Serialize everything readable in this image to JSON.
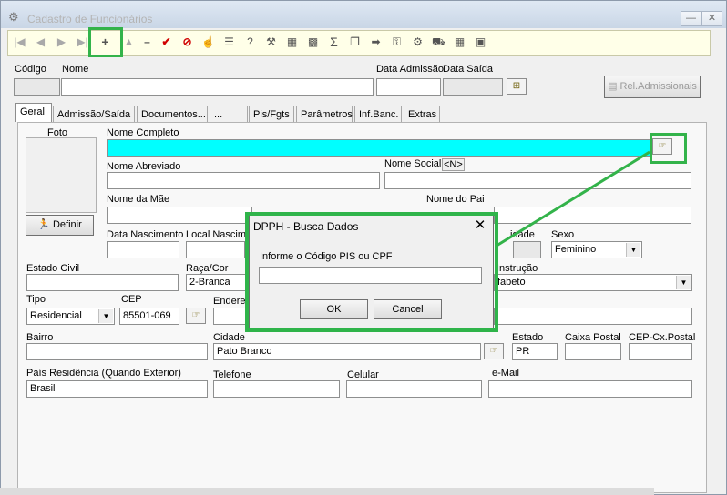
{
  "window": {
    "title": "Cadastro de Funcionários"
  },
  "header": {
    "codigo_label": "Código",
    "nome_label": "Nome",
    "data_admissao_label": "Data Admissão",
    "data_saida_label": "Data Saída",
    "rel_button": "Rel.Admissionais"
  },
  "tabs": [
    "Geral",
    "Admissão/Saída",
    "Documentos...",
    "...",
    "Pis/Fgts",
    "Parâmetros",
    "Inf.Banc.",
    "Extras"
  ],
  "form": {
    "foto_label": "Foto",
    "definir_button": "Definir",
    "nome_completo_label": "Nome Completo",
    "nome_abreviado_label": "Nome Abreviado",
    "nome_social_label": "Nome Social",
    "nome_social_button": "<N>",
    "nome_mae_label": "Nome da Mãe",
    "nome_pai_label": "Nome do Pai",
    "data_nascimento_label": "Data Nascimento",
    "local_nascimento_label": "Local Nascim",
    "idade_label": "idade",
    "sexo_label": "Sexo",
    "sexo_value": "Feminino",
    "estado_civil_label": "Estado Civil",
    "raca_cor_label": "Raça/Cor",
    "raca_cor_value": "2-Branca",
    "instrucao_label": "Instrução",
    "instrucao_value": "fabeto",
    "tipo_label": "Tipo",
    "tipo_value": "Residencial",
    "cep_label": "CEP",
    "cep_value": "85501-069",
    "endereco_label": "Endere",
    "bairro_label": "Bairro",
    "cidade_label": "Cidade",
    "cidade_value": "Pato Branco",
    "estado_label": "Estado",
    "estado_value": "PR",
    "caixa_postal_label": "Caixa Postal",
    "cep_cx_postal_label": "CEP-Cx.Postal",
    "pais_label": "País Residência (Quando Exterior)",
    "pais_value": "Brasil",
    "telefone_label": "Telefone",
    "celular_label": "Celular",
    "email_label": "e-Mail"
  },
  "dialog": {
    "title": "DPPH - Busca Dados",
    "prompt": "Informe o Código PIS ou CPF",
    "ok": "OK",
    "cancel": "Cancel"
  },
  "colors": {
    "highlight_field": "#00ffff",
    "annotation_green": "#33b34a",
    "toolbar_bg": "#ffffe8"
  }
}
